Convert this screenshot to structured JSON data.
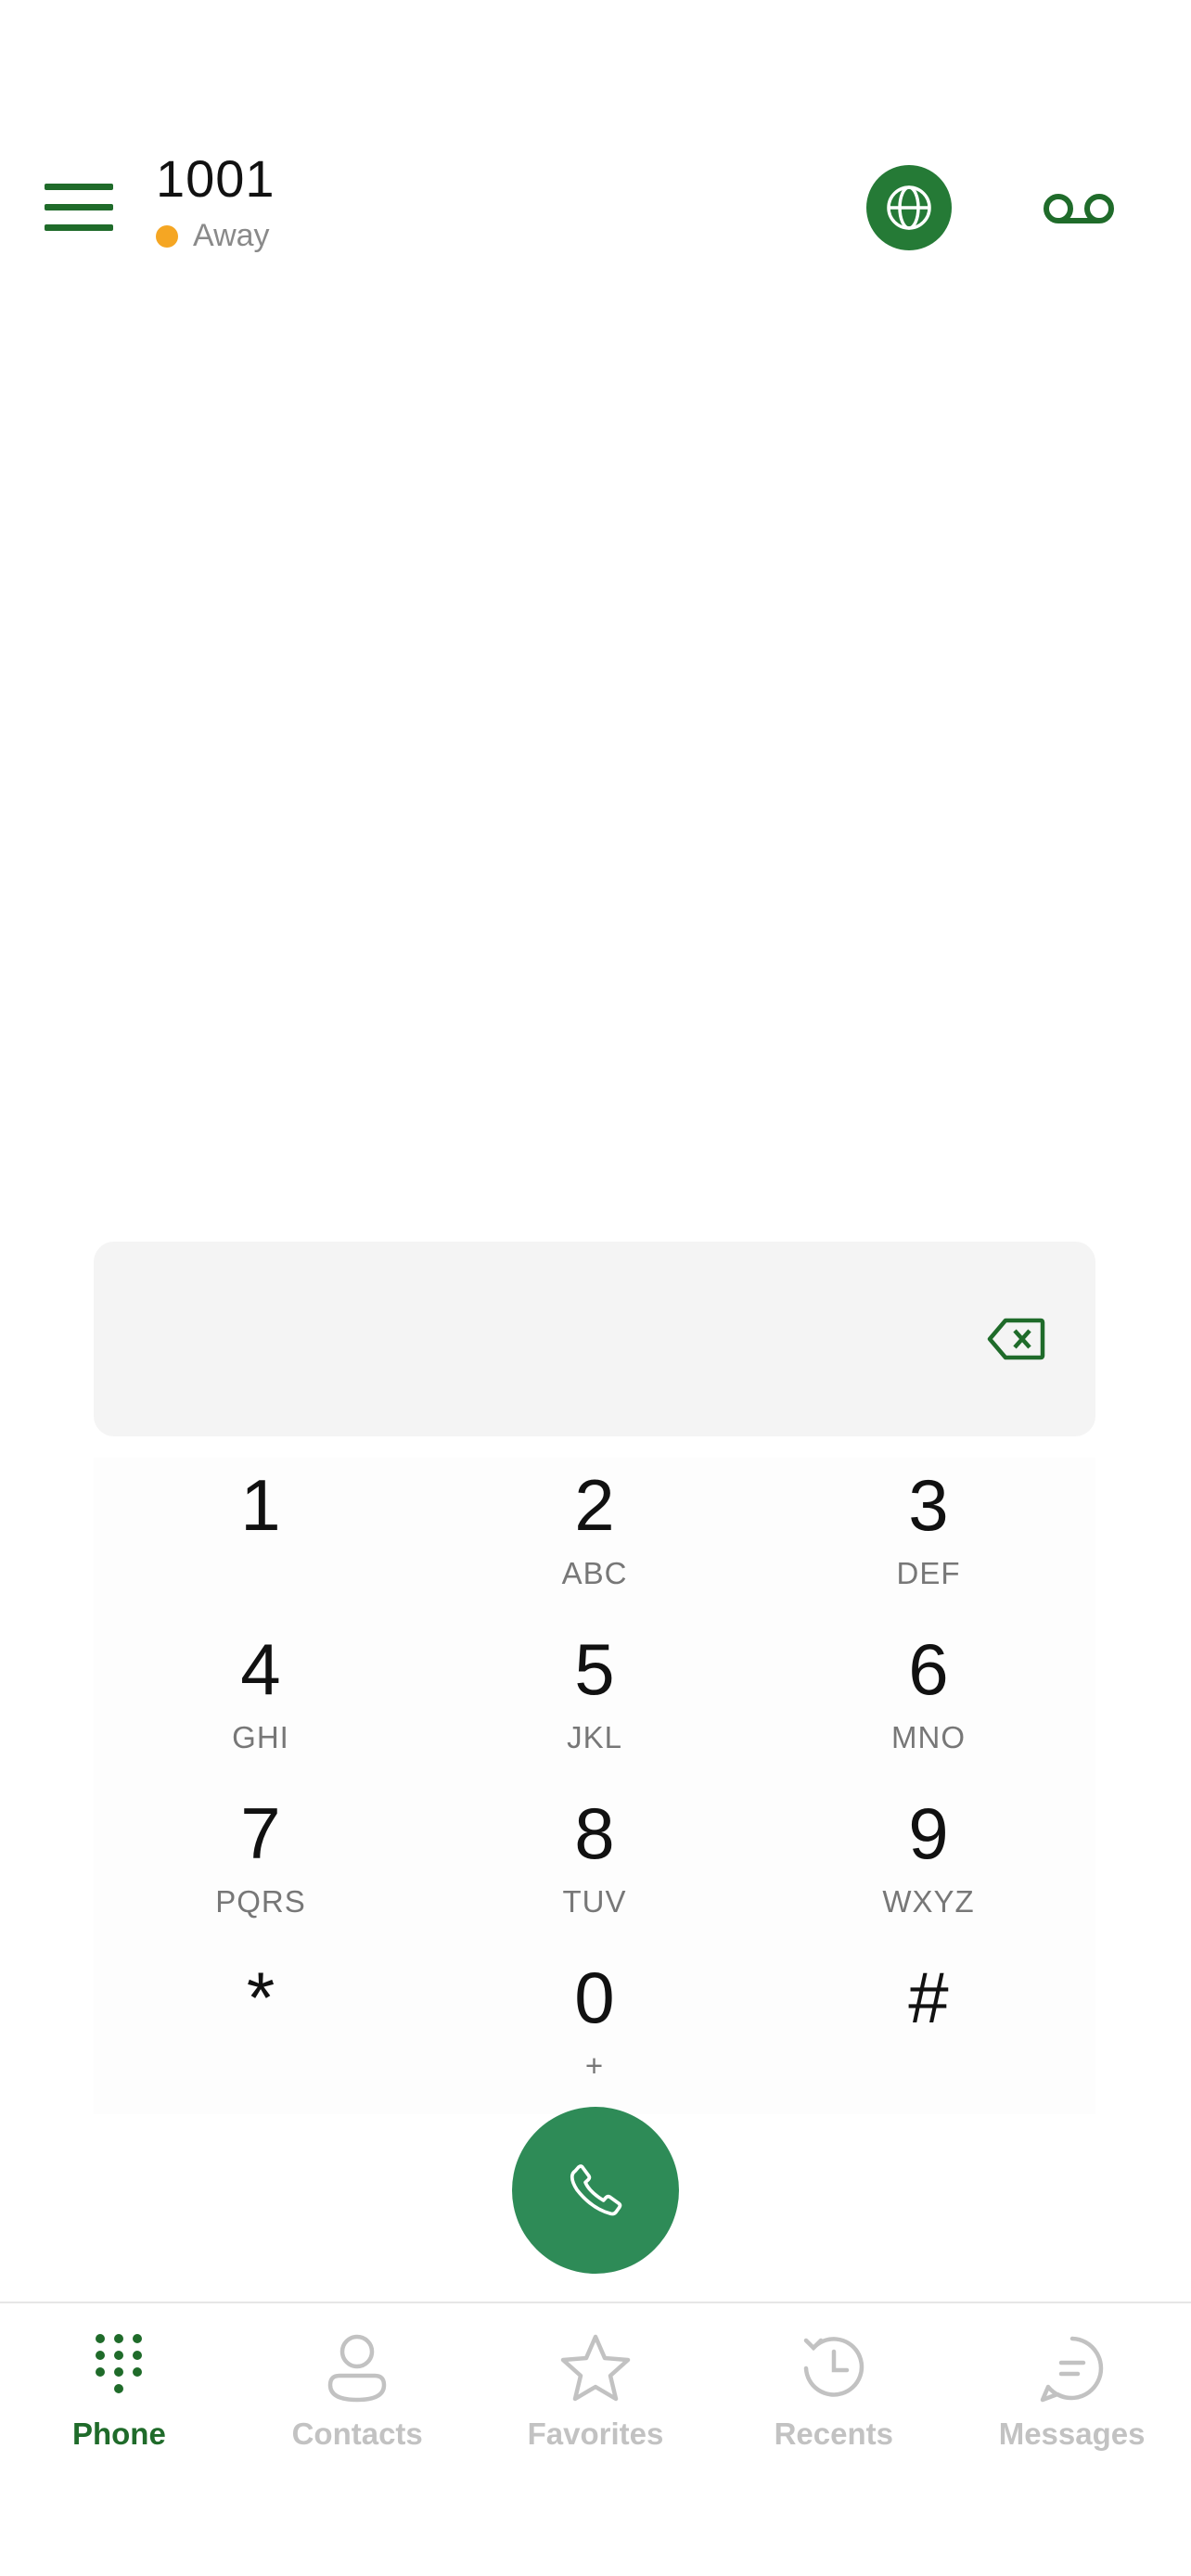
{
  "header": {
    "extension": "1001",
    "status": "Away",
    "status_color": "#f5a623",
    "menu_icon": "hamburger-menu-icon",
    "globe_icon": "globe-icon",
    "voicemail_icon": "voicemail-icon"
  },
  "dialer": {
    "number_value": "",
    "backspace_icon": "backspace-icon"
  },
  "keypad": {
    "keys": [
      {
        "digit": "1",
        "letters": ""
      },
      {
        "digit": "2",
        "letters": "ABC"
      },
      {
        "digit": "3",
        "letters": "DEF"
      },
      {
        "digit": "4",
        "letters": "GHI"
      },
      {
        "digit": "5",
        "letters": "JKL"
      },
      {
        "digit": "6",
        "letters": "MNO"
      },
      {
        "digit": "7",
        "letters": "PQRS"
      },
      {
        "digit": "8",
        "letters": "TUV"
      },
      {
        "digit": "9",
        "letters": "WXYZ"
      },
      {
        "digit": "*",
        "letters": ""
      },
      {
        "digit": "0",
        "letters": "+"
      },
      {
        "digit": "#",
        "letters": ""
      }
    ]
  },
  "call_button": {
    "icon": "phone-icon",
    "color": "#2e8b57"
  },
  "bottom_nav": {
    "items": [
      {
        "label": "Phone",
        "icon": "dialpad-icon",
        "active": true
      },
      {
        "label": "Contacts",
        "icon": "person-icon",
        "active": false
      },
      {
        "label": "Favorites",
        "icon": "star-icon",
        "active": false
      },
      {
        "label": "Recents",
        "icon": "history-icon",
        "active": false
      },
      {
        "label": "Messages",
        "icon": "chat-bubble-icon",
        "active": false
      }
    ],
    "active_color": "#1f6b2a",
    "inactive_color": "#c2c2c2"
  },
  "colors": {
    "brand_green": "#257a36"
  }
}
